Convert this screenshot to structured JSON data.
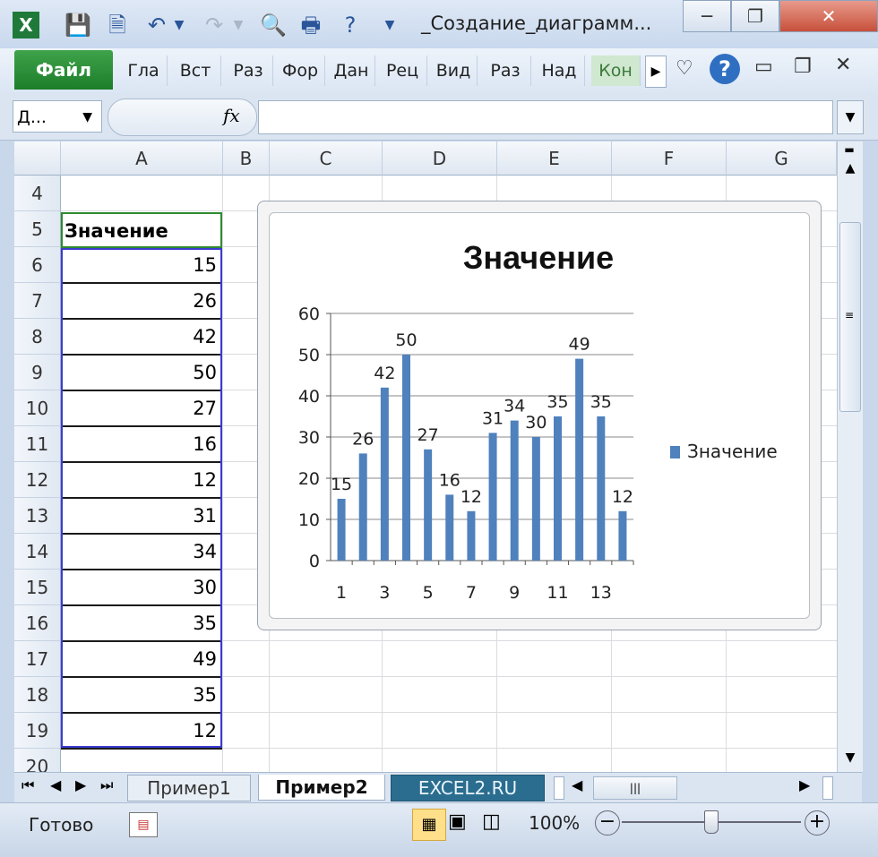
{
  "window": {
    "title": "_Создание_диаграмм...",
    "minimize": "─",
    "restore": "❐",
    "close": "✕"
  },
  "ribbon": {
    "file_tab": "Файл",
    "tabs": [
      "Гла",
      "Вст",
      "Раз",
      "Фор",
      "Дан",
      "Рец",
      "Вид",
      "Раз",
      "Над",
      "Кон"
    ]
  },
  "formula_bar": {
    "name_box": "Д...",
    "fx_label": "fx",
    "value": ""
  },
  "grid": {
    "columns": [
      "A",
      "B",
      "C",
      "D",
      "E",
      "F",
      "G"
    ],
    "rows": [
      "4",
      "5",
      "6",
      "7",
      "8",
      "9",
      "10",
      "11",
      "12",
      "13",
      "14",
      "15",
      "16",
      "17",
      "18",
      "19",
      "20"
    ],
    "header_cell": "Значение",
    "values": [
      "15",
      "26",
      "42",
      "50",
      "27",
      "16",
      "12",
      "31",
      "34",
      "30",
      "35",
      "49",
      "35",
      "12"
    ]
  },
  "chart_data": {
    "type": "bar",
    "title": "Значение",
    "categories": [
      "1",
      "2",
      "3",
      "4",
      "5",
      "6",
      "7",
      "8",
      "9",
      "10",
      "11",
      "12",
      "13",
      "14"
    ],
    "series": [
      {
        "name": "Значение",
        "values": [
          15,
          26,
          42,
          50,
          27,
          16,
          12,
          31,
          34,
          30,
          35,
          49,
          35,
          12
        ]
      }
    ],
    "x_tick_labels": [
      "1",
      "3",
      "5",
      "7",
      "9",
      "11",
      "13"
    ],
    "y_tick_labels": [
      "0",
      "10",
      "20",
      "30",
      "40",
      "50",
      "60"
    ],
    "ylim": [
      0,
      60
    ],
    "grid": true,
    "legend_position": "right",
    "data_labels": true,
    "bar_color": "#4f81bd"
  },
  "sheets": {
    "tabs": [
      "Пример1",
      "Пример2",
      "EXCEL2.RU"
    ],
    "active": "Пример2"
  },
  "status": {
    "text": "Готово",
    "zoom": "100%"
  }
}
